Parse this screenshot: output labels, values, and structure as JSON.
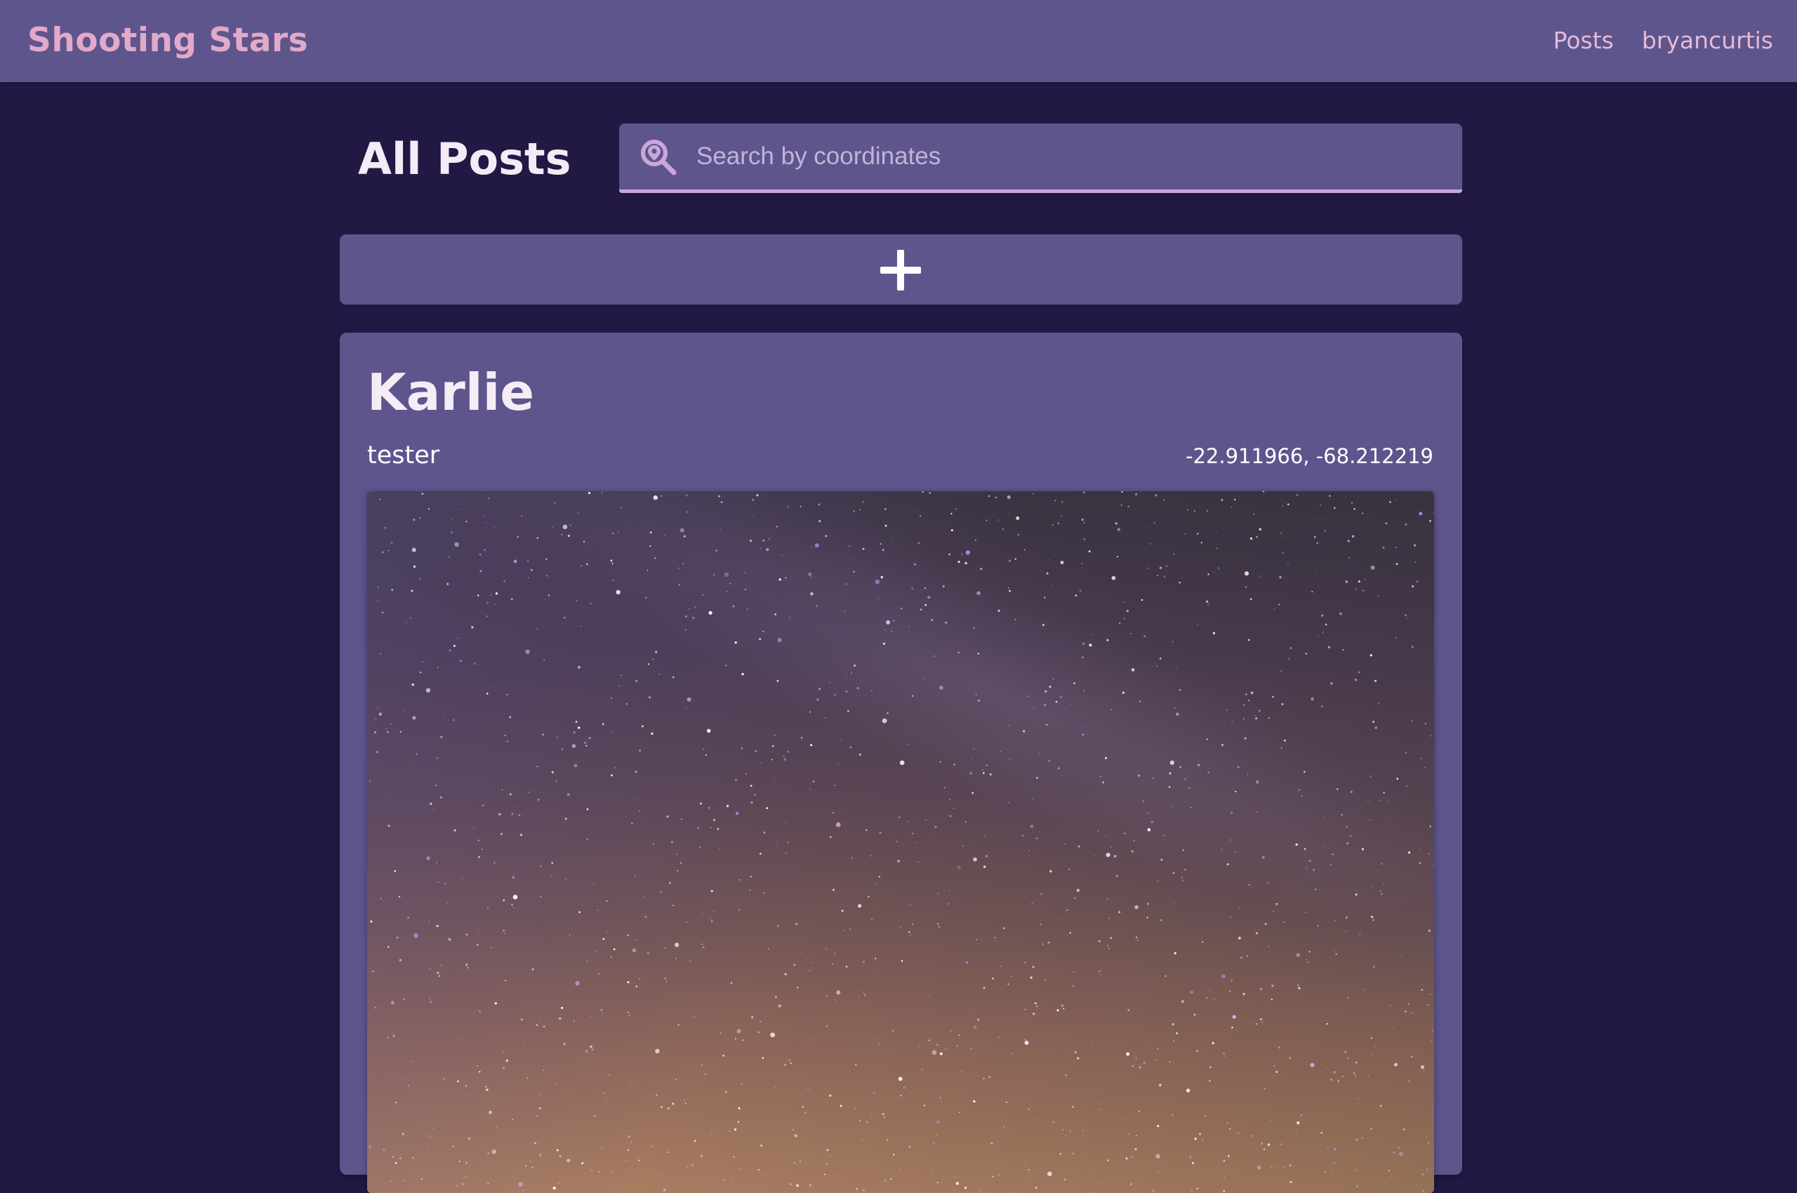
{
  "navbar": {
    "brand": "Shooting Stars",
    "links": [
      "Posts",
      "bryancurtis"
    ]
  },
  "page": {
    "title": "All Posts"
  },
  "search": {
    "placeholder": "Search by coordinates",
    "value": ""
  },
  "add_button": {
    "icon": "plus-icon"
  },
  "posts": [
    {
      "title": "Karlie",
      "author": "tester",
      "coordinates": "-22.911966, -68.212219",
      "image_alt": "night sky with stars"
    }
  ],
  "colors": {
    "background": "#211944",
    "panel": "#5e558d",
    "brand": "#e2a9c9",
    "search_underline": "#c9a7d8"
  }
}
